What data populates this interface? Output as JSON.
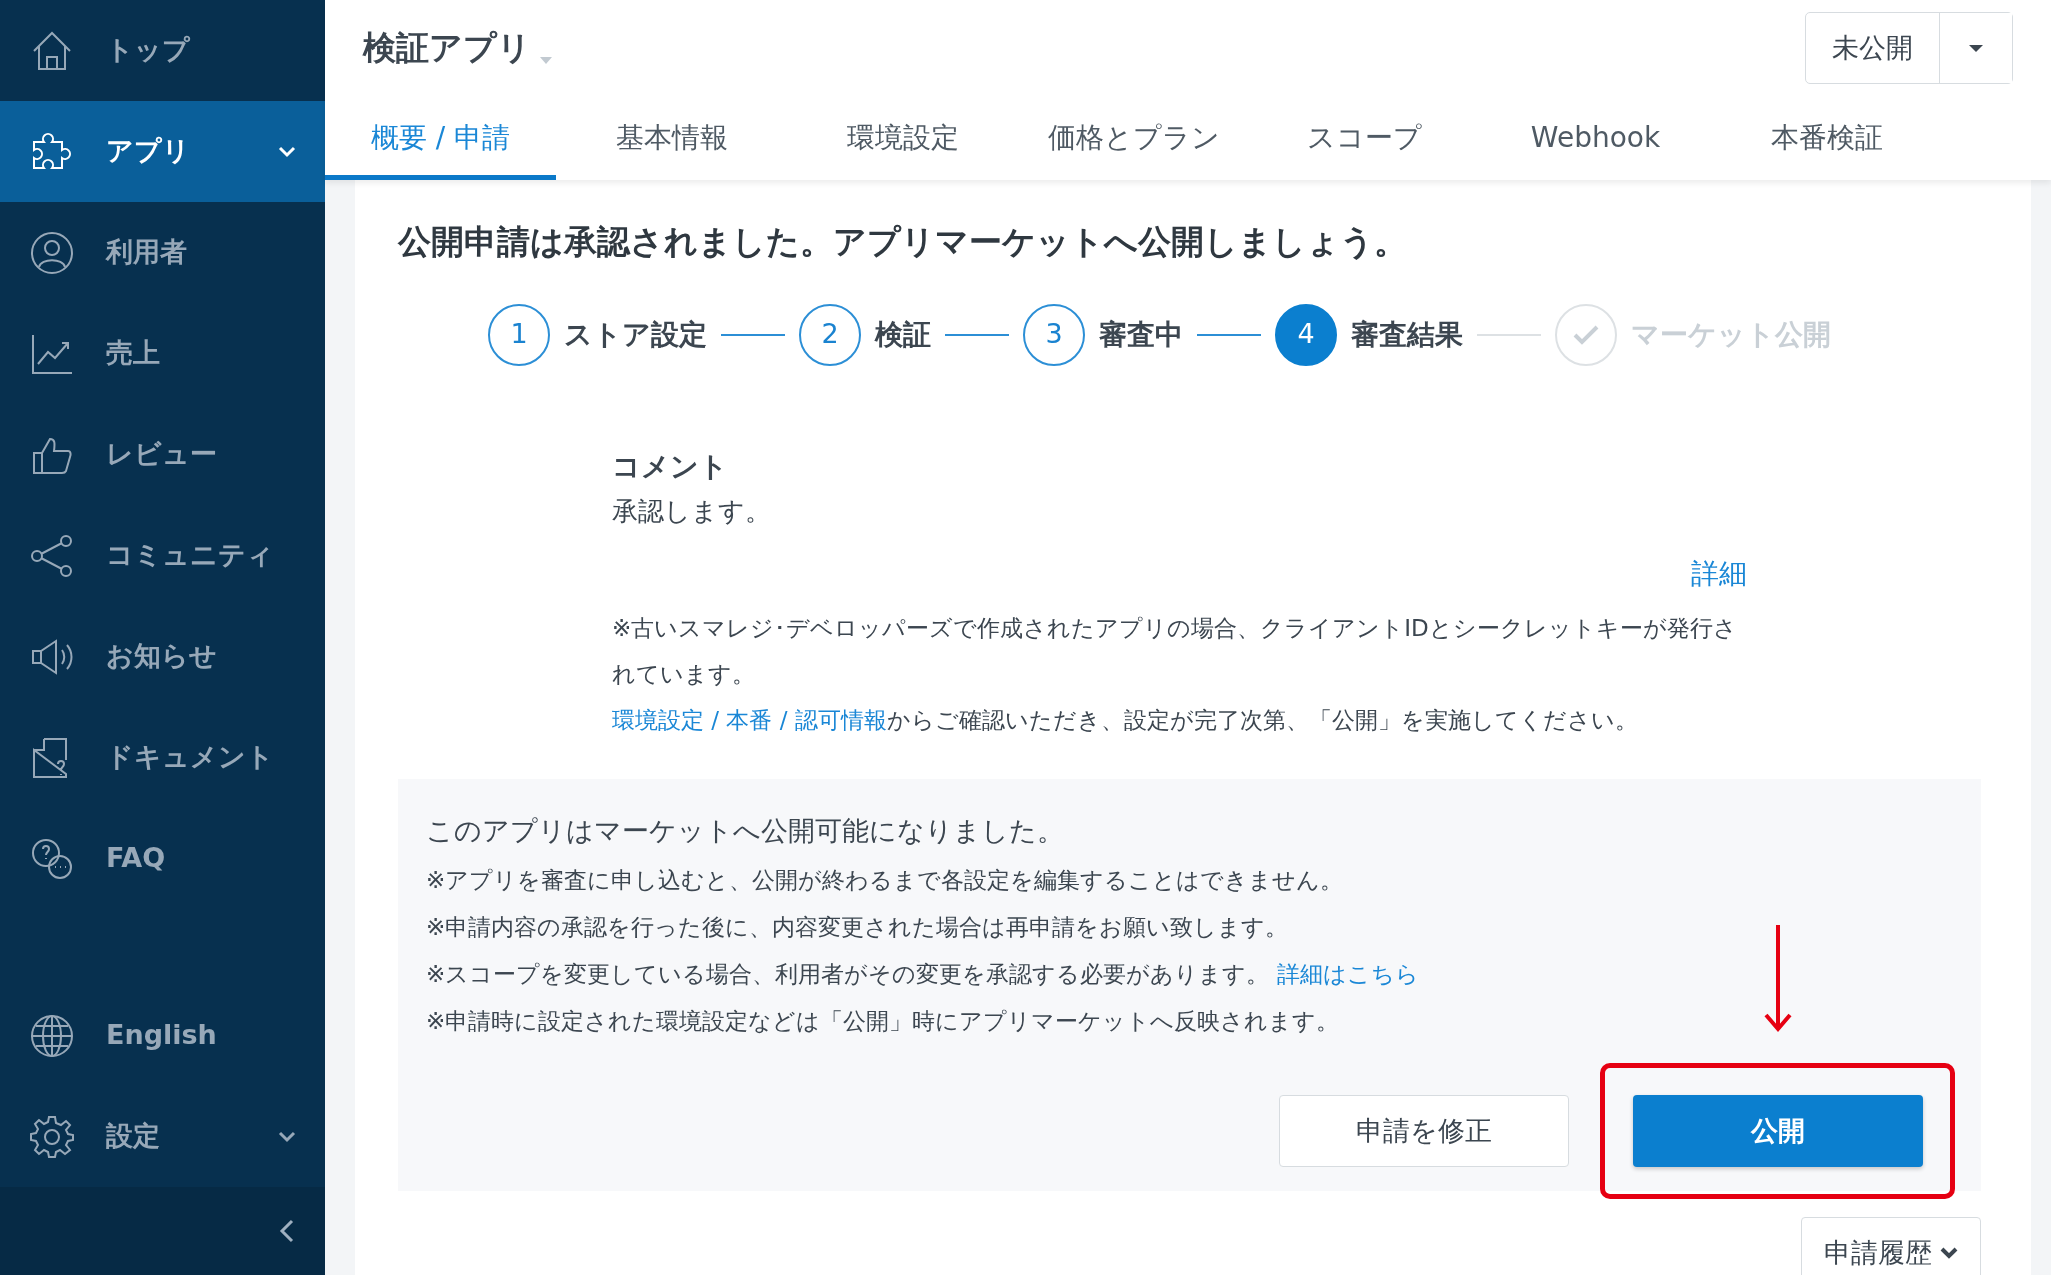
{
  "sidebar": {
    "items": [
      {
        "label": "トップ",
        "selected": false,
        "expandable": false
      },
      {
        "label": "アプリ",
        "selected": true,
        "expandable": true
      },
      {
        "label": "利用者",
        "selected": false,
        "expandable": false
      },
      {
        "label": "売上",
        "selected": false,
        "expandable": false
      },
      {
        "label": "レビュー",
        "selected": false,
        "expandable": false
      },
      {
        "label": "コミュニティ",
        "selected": false,
        "expandable": false
      },
      {
        "label": "お知らせ",
        "selected": false,
        "expandable": false
      },
      {
        "label": "ドキュメント",
        "selected": false,
        "expandable": false
      },
      {
        "label": "FAQ",
        "selected": false,
        "expandable": false
      }
    ],
    "bottom_items": [
      {
        "label": "English",
        "selected": false,
        "expandable": false
      },
      {
        "label": "設定",
        "selected": false,
        "expandable": true
      }
    ]
  },
  "header": {
    "title": "検証アプリ",
    "status": "未公開"
  },
  "tabs": [
    {
      "label": "概要 / 申請",
      "selected": true
    },
    {
      "label": "基本情報",
      "selected": false
    },
    {
      "label": "環境設定",
      "selected": false
    },
    {
      "label": "価格とプラン",
      "selected": false
    },
    {
      "label": "スコープ",
      "selected": false
    },
    {
      "label": "Webhook",
      "selected": false
    },
    {
      "label": "本番検証",
      "selected": false
    }
  ],
  "heading": "公開申請は承認されました。アプリマーケットへ公開しましょう。",
  "steps": [
    {
      "number": "1",
      "label": "ストア設定",
      "done": true,
      "current": false
    },
    {
      "number": "2",
      "label": "検証",
      "done": true,
      "current": false
    },
    {
      "number": "3",
      "label": "審査中",
      "done": true,
      "current": false
    },
    {
      "number": "4",
      "label": "審査結果",
      "done": false,
      "current": true
    },
    {
      "label": "マーケット公開",
      "done": false,
      "current": false
    }
  ],
  "comment": {
    "title": "コメント",
    "body": "承認します。",
    "detail_link": "詳細",
    "note": "※古いスマレジ･デベロッパーズで作成されたアプリの場合、クライアントIDとシークレットキーが発行されています。",
    "settings_link": "環境設定 / 本番 / 認可情報",
    "settings_text": "からご確認いただき、設定が完了次第、「公開」を実施してください。"
  },
  "publish_box": {
    "lead": "このアプリはマーケットへ公開可能になりました。",
    "notes": [
      {
        "text": "※アプリを審査に申し込むと、公開が終わるまで各設定を編集することはできません。"
      },
      {
        "text": "※申請内容の承認を行った後に、内容変更された場合は再申請をお願い致します。"
      },
      {
        "text": "※スコープを変更している場合、利用者がその変更を承認する必要があります。",
        "link": "詳細はこちら"
      },
      {
        "text": "※申請時に設定された環境設定などは「公開」時にアプリマーケットへ反映されます。"
      }
    ],
    "actions": [
      {
        "label": "申請を修正",
        "kind": "secondary",
        "highlighted": false
      },
      {
        "label": "公開",
        "kind": "primary",
        "highlighted": true
      }
    ]
  },
  "history_button": "申請履歴"
}
